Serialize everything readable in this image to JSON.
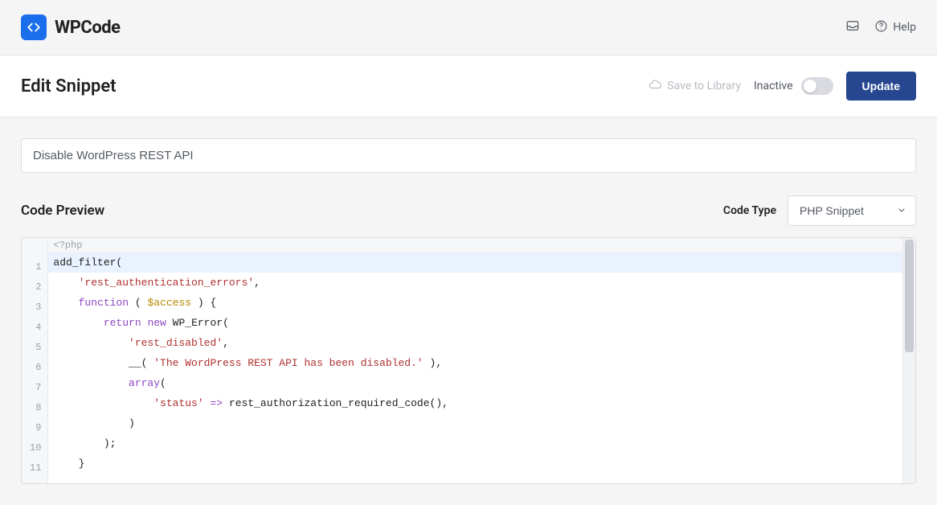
{
  "brand": {
    "name": "WPCode"
  },
  "top_nav": {
    "help_label": "Help"
  },
  "toolbar": {
    "title": "Edit Snippet",
    "save_library_label": "Save to Library",
    "status_label": "Inactive",
    "update_label": "Update"
  },
  "snippet": {
    "title": "Disable WordPress REST API"
  },
  "section": {
    "preview_label": "Code Preview",
    "code_type_label": "Code Type",
    "code_type_value": "PHP Snippet"
  },
  "code": {
    "readonly_prefix": "<?php",
    "lines": [
      {
        "tokens": [
          {
            "t": "fn",
            "v": "add_filter"
          },
          {
            "t": "",
            "v": "("
          }
        ]
      },
      {
        "indent": 1,
        "tokens": [
          {
            "t": "str",
            "v": "'rest_authentication_errors'"
          },
          {
            "t": "",
            "v": ","
          }
        ]
      },
      {
        "indent": 1,
        "tokens": [
          {
            "t": "kw",
            "v": "function"
          },
          {
            "t": "",
            "v": " ( "
          },
          {
            "t": "var",
            "v": "$access"
          },
          {
            "t": "",
            "v": " ) {"
          }
        ]
      },
      {
        "indent": 2,
        "tokens": [
          {
            "t": "kw",
            "v": "return"
          },
          {
            "t": "",
            "v": " "
          },
          {
            "t": "kw",
            "v": "new"
          },
          {
            "t": "",
            "v": " "
          },
          {
            "t": "cls",
            "v": "WP_Error"
          },
          {
            "t": "",
            "v": "("
          }
        ]
      },
      {
        "indent": 3,
        "tokens": [
          {
            "t": "str",
            "v": "'rest_disabled'"
          },
          {
            "t": "",
            "v": ","
          }
        ]
      },
      {
        "indent": 3,
        "tokens": [
          {
            "t": "fn",
            "v": "__"
          },
          {
            "t": "",
            "v": "( "
          },
          {
            "t": "str",
            "v": "'The WordPress REST API has been disabled.'"
          },
          {
            "t": "",
            "v": " ),"
          }
        ]
      },
      {
        "indent": 3,
        "tokens": [
          {
            "t": "kw",
            "v": "array"
          },
          {
            "t": "",
            "v": "("
          }
        ]
      },
      {
        "indent": 4,
        "tokens": [
          {
            "t": "str",
            "v": "'status'"
          },
          {
            "t": "",
            "v": " "
          },
          {
            "t": "op",
            "v": "=>"
          },
          {
            "t": "",
            "v": " "
          },
          {
            "t": "fn",
            "v": "rest_authorization_required_code"
          },
          {
            "t": "",
            "v": "(),"
          }
        ]
      },
      {
        "indent": 3,
        "tokens": [
          {
            "t": "",
            "v": ")"
          }
        ]
      },
      {
        "indent": 2,
        "tokens": [
          {
            "t": "",
            "v": ");"
          }
        ]
      },
      {
        "indent": 1,
        "tokens": [
          {
            "t": "",
            "v": "}"
          }
        ]
      }
    ]
  }
}
